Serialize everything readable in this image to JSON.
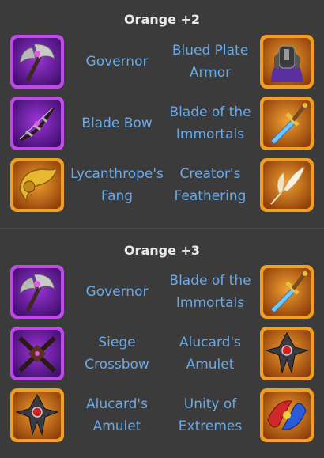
{
  "sections": [
    {
      "title": "Orange +2",
      "rows": [
        {
          "left": {
            "name": "Governor",
            "icon": "axe-icon",
            "frame": "#c04ae8"
          },
          "right": {
            "name": "Blued Plate Armor",
            "icon": "armor-icon",
            "frame": "#f0a020"
          }
        },
        {
          "left": {
            "name": "Blade Bow",
            "icon": "bow-icon",
            "frame": "#c04ae8"
          },
          "right": {
            "name": "Blade of the Immortals",
            "icon": "sword-icon",
            "frame": "#f0a020"
          }
        },
        {
          "left": {
            "name": "Lycanthrope's Fang",
            "icon": "fang-icon",
            "frame": "#f0a020"
          },
          "right": {
            "name": "Creator's Feathering",
            "icon": "feather-icon",
            "frame": "#f0a020"
          }
        }
      ]
    },
    {
      "title": "Orange +3",
      "rows": [
        {
          "left": {
            "name": "Governor",
            "icon": "axe-icon",
            "frame": "#c04ae8"
          },
          "right": {
            "name": "Blade of the Immortals",
            "icon": "sword-icon",
            "frame": "#f0a020"
          }
        },
        {
          "left": {
            "name": "Siege Crossbow",
            "icon": "crossbow-icon",
            "frame": "#c04ae8"
          },
          "right": {
            "name": "Alucard's Amulet",
            "icon": "amulet-icon",
            "frame": "#f0a020"
          }
        },
        {
          "left": {
            "name": "Alucard's Amulet",
            "icon": "amulet-icon",
            "frame": "#f0a020"
          },
          "right": {
            "name": "Unity of Extremes",
            "icon": "unity-icon",
            "frame": "#f0a020"
          }
        }
      ]
    }
  ]
}
